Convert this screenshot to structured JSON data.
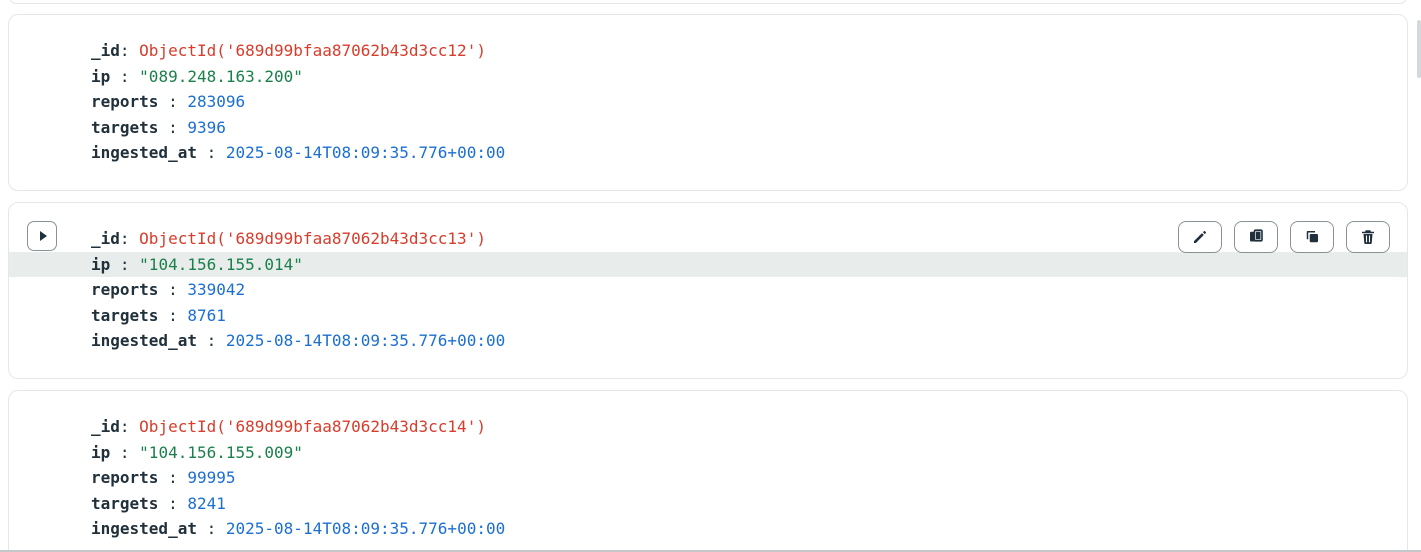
{
  "documents": [
    {
      "fields": [
        {
          "key": "_id",
          "sep": ": ",
          "value": "ObjectId('689d99bfaa87062b43d3cc12')",
          "type": "oid"
        },
        {
          "key": "ip",
          "sep": " : ",
          "value": "\"089.248.163.200\"",
          "type": "str"
        },
        {
          "key": "reports",
          "sep": " : ",
          "value": "283096",
          "type": "num"
        },
        {
          "key": "targets",
          "sep": " : ",
          "value": "9396",
          "type": "num"
        },
        {
          "key": "ingested_at",
          "sep": " : ",
          "value": "2025-08-14T08:09:35.776+00:00",
          "type": "date"
        }
      ]
    },
    {
      "fields": [
        {
          "key": "_id",
          "sep": ": ",
          "value": "ObjectId('689d99bfaa87062b43d3cc13')",
          "type": "oid"
        },
        {
          "key": "ip",
          "sep": " : ",
          "value": "\"104.156.155.014\"",
          "type": "str"
        },
        {
          "key": "reports",
          "sep": " : ",
          "value": "339042",
          "type": "num"
        },
        {
          "key": "targets",
          "sep": " : ",
          "value": "8761",
          "type": "num"
        },
        {
          "key": "ingested_at",
          "sep": " : ",
          "value": "2025-08-14T08:09:35.776+00:00",
          "type": "date"
        }
      ]
    },
    {
      "fields": [
        {
          "key": "_id",
          "sep": ": ",
          "value": "ObjectId('689d99bfaa87062b43d3cc14')",
          "type": "oid"
        },
        {
          "key": "ip",
          "sep": " : ",
          "value": "\"104.156.155.009\"",
          "type": "str"
        },
        {
          "key": "reports",
          "sep": " : ",
          "value": "99995",
          "type": "num"
        },
        {
          "key": "targets",
          "sep": " : ",
          "value": "8241",
          "type": "num"
        },
        {
          "key": "ingested_at",
          "sep": " : ",
          "value": "2025-08-14T08:09:35.776+00:00",
          "type": "date"
        }
      ]
    }
  ],
  "toolbar": {
    "buttons": [
      {
        "name": "edit-document-button",
        "icon": "pencil-icon"
      },
      {
        "name": "copy-document-button",
        "icon": "copy-icon"
      },
      {
        "name": "clone-document-button",
        "icon": "clone-icon"
      },
      {
        "name": "delete-document-button",
        "icon": "trash-icon"
      }
    ],
    "expand_icon": "caret-right-icon"
  },
  "colors": {
    "object_id": "#d83c2b",
    "string": "#1a7f4b",
    "number": "#1b6fd1",
    "key": "#21313c",
    "highlight_row": "#e8edeb"
  }
}
